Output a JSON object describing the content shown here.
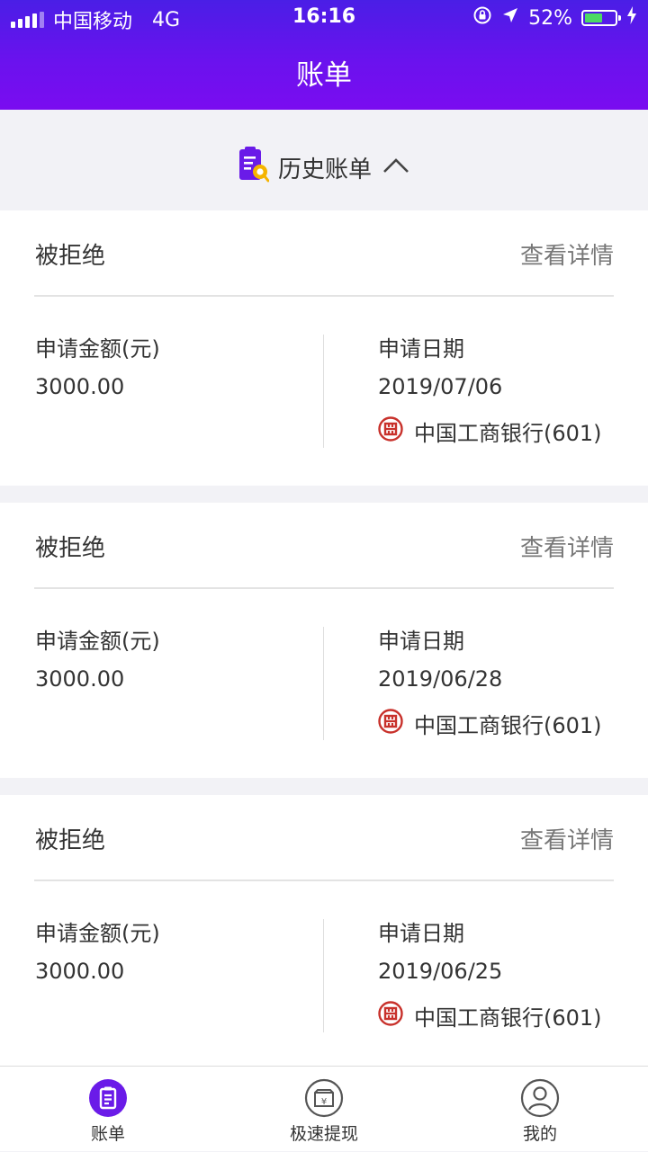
{
  "status_bar": {
    "carrier": "中国移动",
    "network": "4G",
    "time": "16:16",
    "battery": "52%"
  },
  "header": {
    "title": "账单"
  },
  "history": {
    "label": "历史账单",
    "expanded": true
  },
  "bills": [
    {
      "status": "被拒绝",
      "detail_link": "查看详情",
      "amount_label": "申请金额(元)",
      "amount": "3000.00",
      "date_label": "申请日期",
      "date": "2019/07/06",
      "bank": "中国工商银行(601)"
    },
    {
      "status": "被拒绝",
      "detail_link": "查看详情",
      "amount_label": "申请金额(元)",
      "amount": "3000.00",
      "date_label": "申请日期",
      "date": "2019/06/28",
      "bank": "中国工商银行(601)"
    },
    {
      "status": "被拒绝",
      "detail_link": "查看详情",
      "amount_label": "申请金额(元)",
      "amount": "3000.00",
      "date_label": "申请日期",
      "date": "2019/06/25",
      "bank": "中国工商银行(601)"
    }
  ],
  "tabs": [
    {
      "label": "账单",
      "icon": "bill-icon",
      "active": true
    },
    {
      "label": "极速提现",
      "icon": "cash-box-icon",
      "active": false
    },
    {
      "label": "我的",
      "icon": "profile-icon",
      "active": false
    }
  ],
  "colors": {
    "header": "#5a16ea",
    "accent": "#6a1be8",
    "bank_logo": "#c8312b",
    "battery": "#4cd964"
  }
}
